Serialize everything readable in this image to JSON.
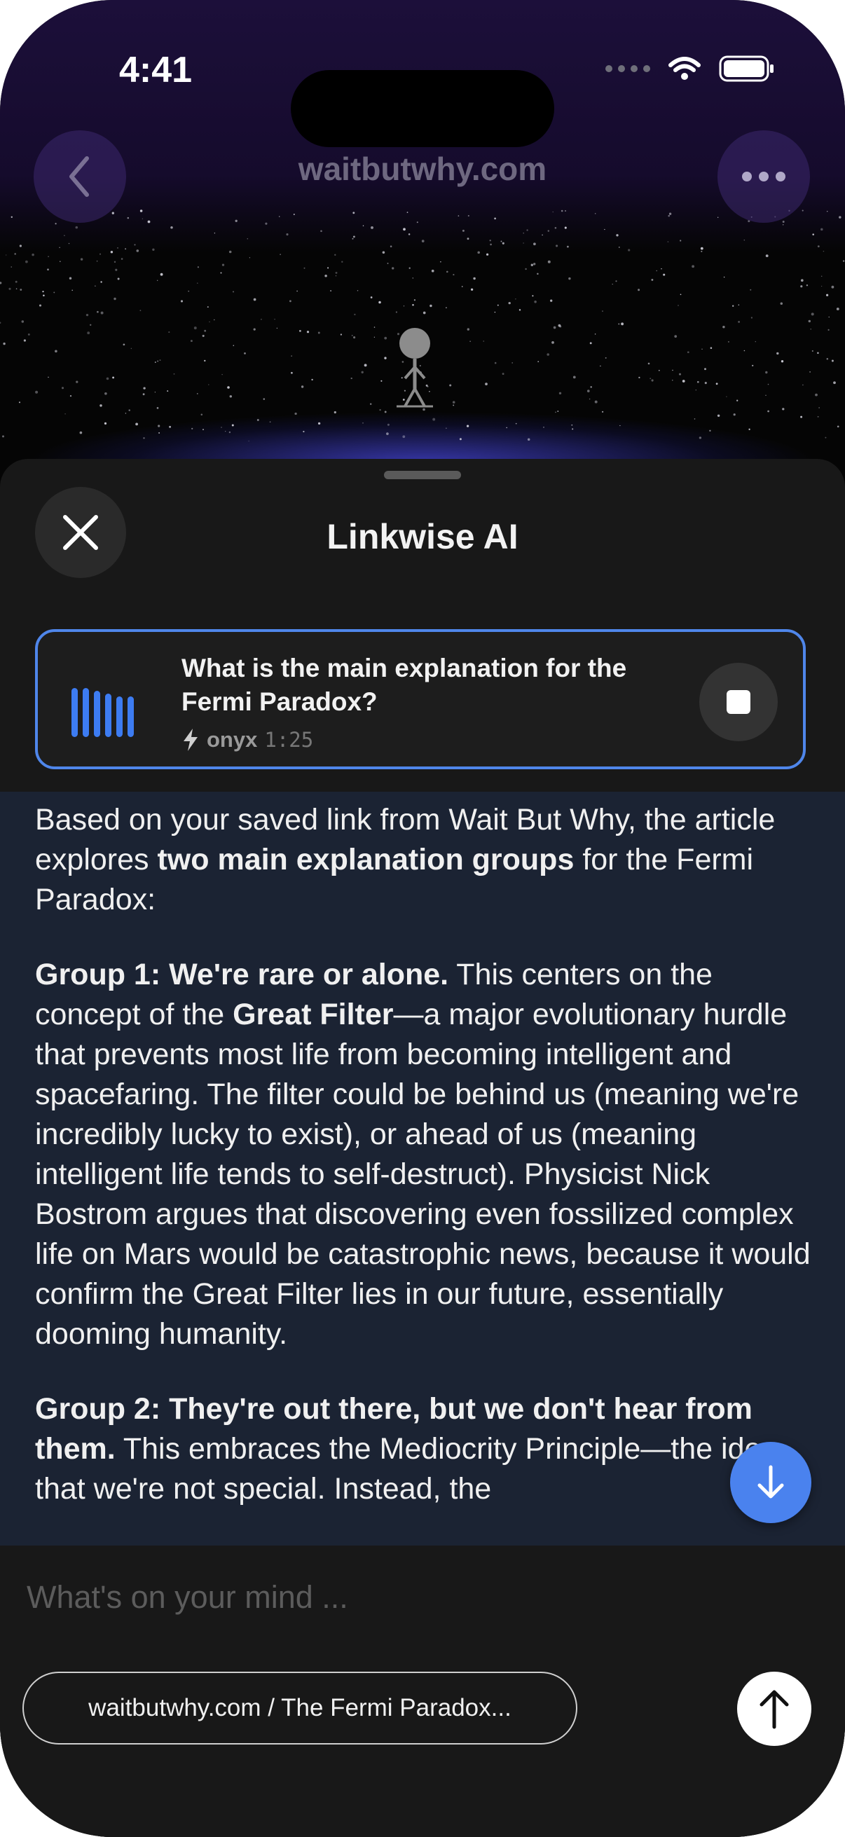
{
  "status_bar": {
    "time": "4:41"
  },
  "browser": {
    "site_title": "waitbutwhy.com"
  },
  "sheet": {
    "title": "Linkwise AI",
    "query": {
      "question": "What is the main explanation for the Fermi Paradox?",
      "model": "onyx",
      "duration": "1:25"
    },
    "answer": {
      "p1_a": "Based on your saved link from Wait But Why, the article explores ",
      "p1_b": "two main explanation groups",
      "p1_c": " for the Fermi Paradox:",
      "p2_a": "Group 1: We're rare or alone.",
      "p2_b": " This centers on the concept of the ",
      "p2_c": "Great Filter",
      "p2_d": "—a major evolutionary hurdle that prevents most life from becoming intelligent and spacefaring. The filter could be behind us (meaning we're incredibly lucky to exist), or ahead of us (meaning intelligent life tends to self-destruct). Physicist Nick Bostrom argues that discovering even fossilized complex life on Mars would be catastrophic news, because it would confirm the Great Filter lies in our future, essentially dooming humanity.",
      "p3_a": "Group 2: They're out there, but we don't hear from them.",
      "p3_b": " This embraces the Mediocrity Principle—the idea that we're not special. Instead, the"
    }
  },
  "composer": {
    "placeholder": "What's on your mind ...",
    "context_chip": "waitbutwhy.com / The Fermi Paradox..."
  },
  "icons": {
    "back": "chevron-left-icon",
    "more": "ellipsis-icon",
    "close": "close-icon",
    "stop": "stop-icon",
    "bolt": "bolt-icon",
    "scroll_down": "arrow-down-icon",
    "send": "arrow-up-icon"
  },
  "colors": {
    "accent": "#4a82ee",
    "answer_bg": "#1b2333",
    "sheet_bg": "#181818"
  }
}
